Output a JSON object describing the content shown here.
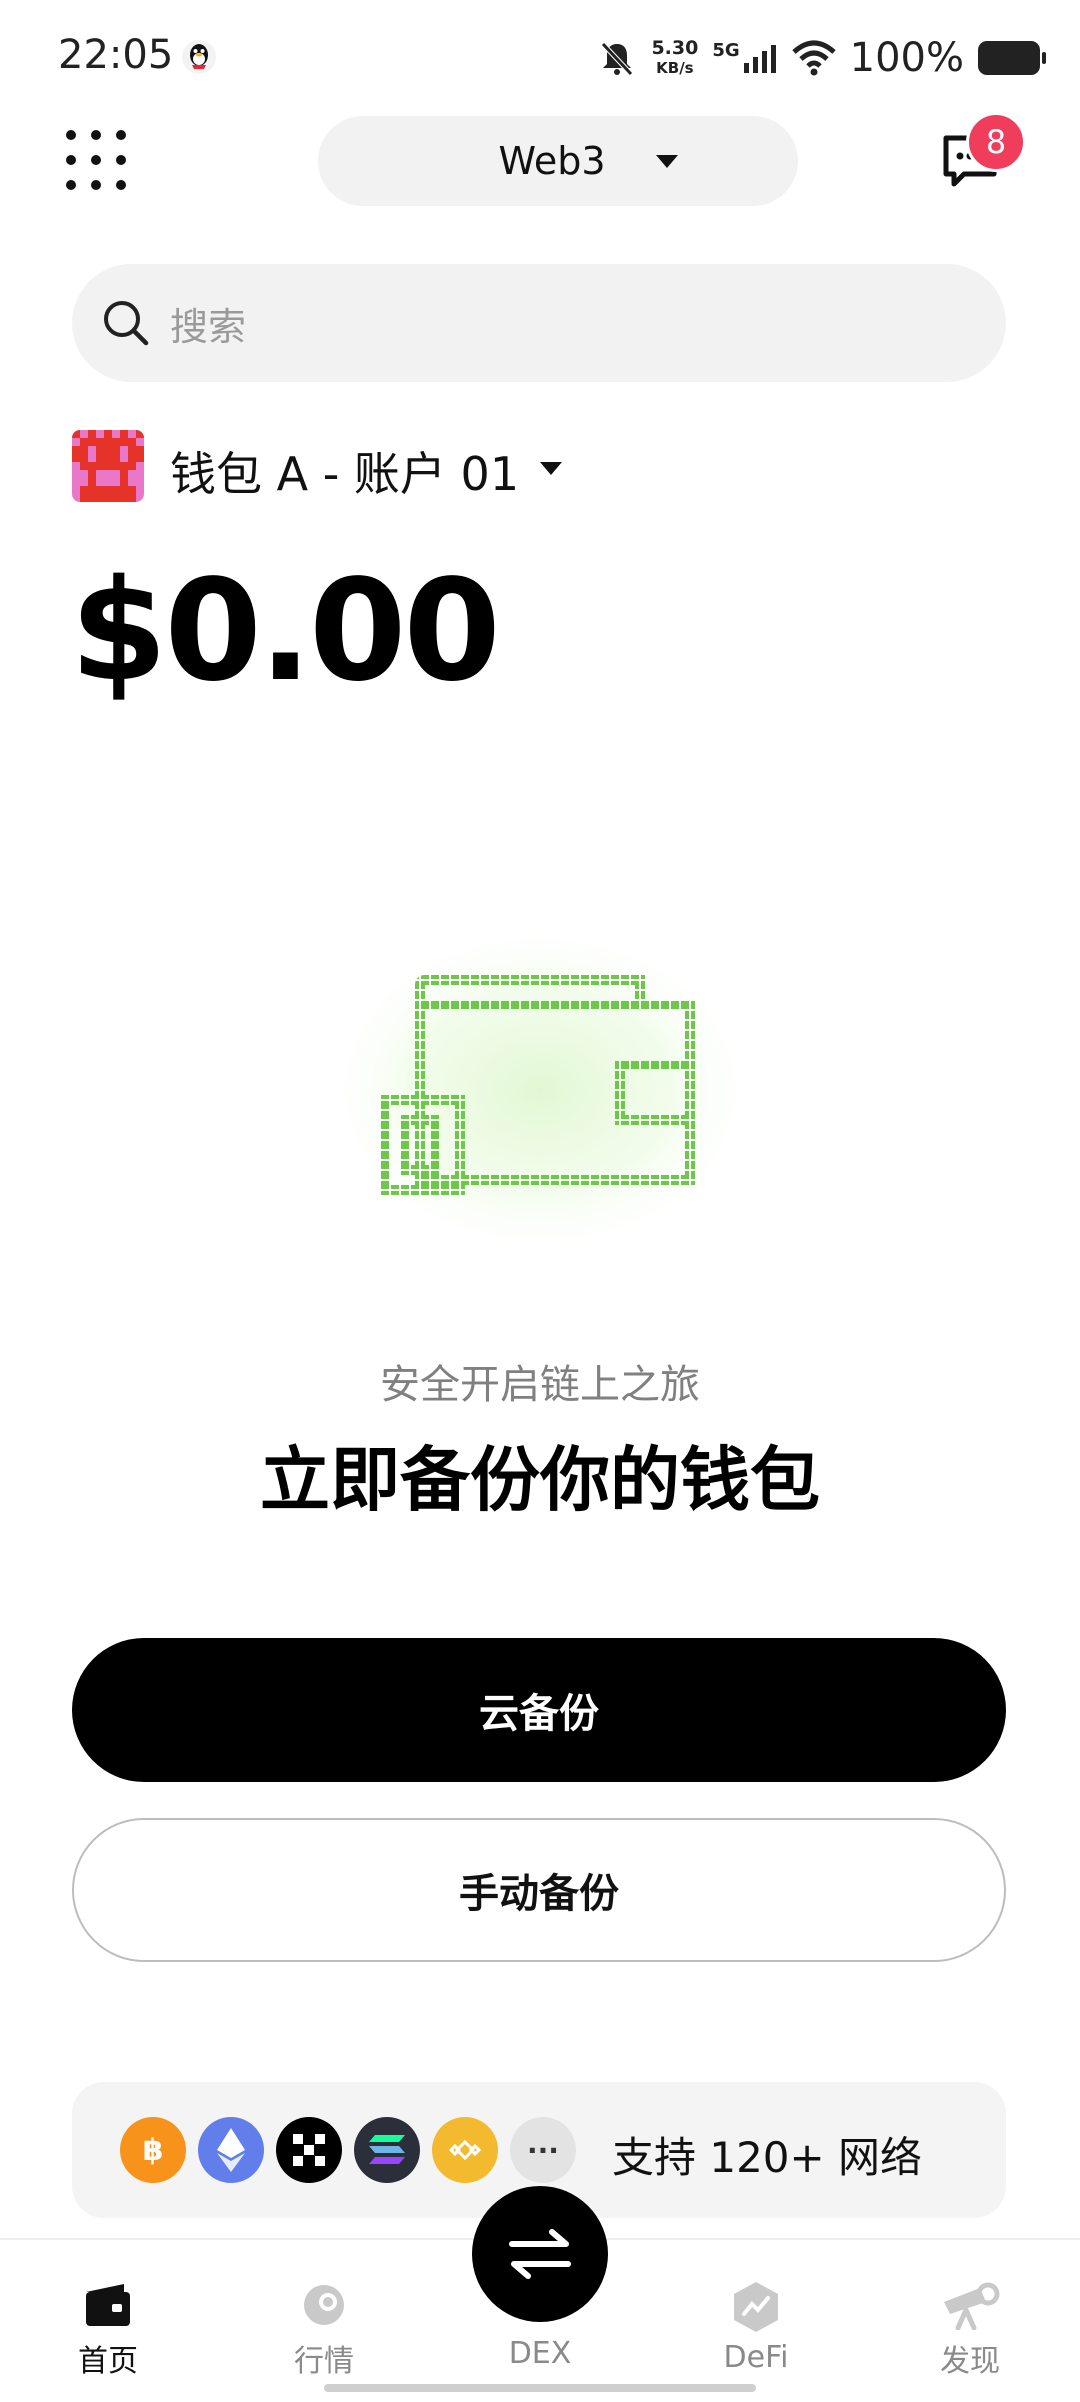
{
  "status_bar": {
    "time": "22:05",
    "net_speed_value": "5.30",
    "net_speed_unit": "KB/s",
    "network": "5G",
    "battery": "100%"
  },
  "header": {
    "mode_label": "Web3",
    "message_badge": "8"
  },
  "search": {
    "placeholder": "搜索"
  },
  "account": {
    "name": "钱包 A - 账户 01",
    "balance": "$0.00"
  },
  "backup": {
    "subtitle": "安全开启链上之旅",
    "headline": "立即备份你的钱包",
    "cloud_label": "云备份",
    "manual_label": "手动备份"
  },
  "networks": {
    "label": "支持 120+ 网络",
    "coin_icons": [
      "bitcoin-icon",
      "ethereum-icon",
      "okb-icon",
      "solana-icon",
      "bnb-icon",
      "more-icon"
    ],
    "more_glyph": "···"
  },
  "nav": {
    "home": "首页",
    "market": "行情",
    "dex": "DEX",
    "defi": "DeFi",
    "discover": "发现"
  },
  "colors": {
    "accent": "#000000",
    "badge": "#ef3d5b",
    "wallet_green": "#6cc74a",
    "bitcoin": "#f7931a",
    "ethereum": "#627eea",
    "bnb": "#f3ba2f"
  }
}
